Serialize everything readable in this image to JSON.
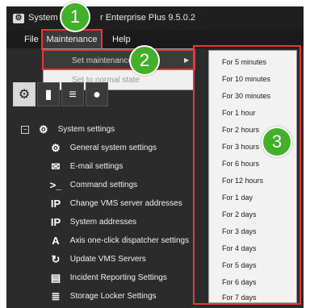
{
  "window": {
    "app_icon": "gear-icon",
    "title_left": "System",
    "title_right": "r Enterprise Plus 9.5.0.2"
  },
  "menubar": {
    "items": [
      "File",
      "Maintenance",
      "Help"
    ]
  },
  "maintenance_menu": {
    "set_maintenance_visible": "Set maintenance m",
    "set_maintenance_tail": "m",
    "set_normal": "Set to normal state"
  },
  "toolbar": {
    "icons": [
      "gear-icon",
      "book-icon",
      "list-icon",
      "people-icon"
    ]
  },
  "tree": {
    "root": "System settings",
    "items": [
      {
        "icon": "gear-icon",
        "label": "General system settings"
      },
      {
        "icon": "mail-icon",
        "label": "E-mail settings"
      },
      {
        "icon": "terminal-icon",
        "label": "Command settings"
      },
      {
        "icon": "ip-icon",
        "label": "Change VMS server addresses"
      },
      {
        "icon": "ip-icon",
        "label": "System addresses"
      },
      {
        "icon": "axis-icon",
        "label": "Axis one-click dispatcher settings"
      },
      {
        "icon": "refresh-icon",
        "label": "Update VMS Servers"
      },
      {
        "icon": "report-icon",
        "label": "Incident Reporting Settings"
      },
      {
        "icon": "storage-icon",
        "label": "Storage Locker Settings"
      }
    ]
  },
  "duration_menu": {
    "items": [
      "For 5 minutes",
      "For 10 minutes",
      "For 30 minutes",
      "For 1 hour",
      "For 2 hours",
      "For 3 hours",
      "For 6 hours",
      "For 12 hours",
      "For 1 day",
      "For 2 days",
      "For 3 days",
      "For 4 days",
      "For 5 days",
      "For 6 days",
      "For 7 days"
    ]
  },
  "callouts": [
    "1",
    "2",
    "3"
  ],
  "colors": {
    "highlight": "#e53935",
    "callout": "#43b02a"
  }
}
